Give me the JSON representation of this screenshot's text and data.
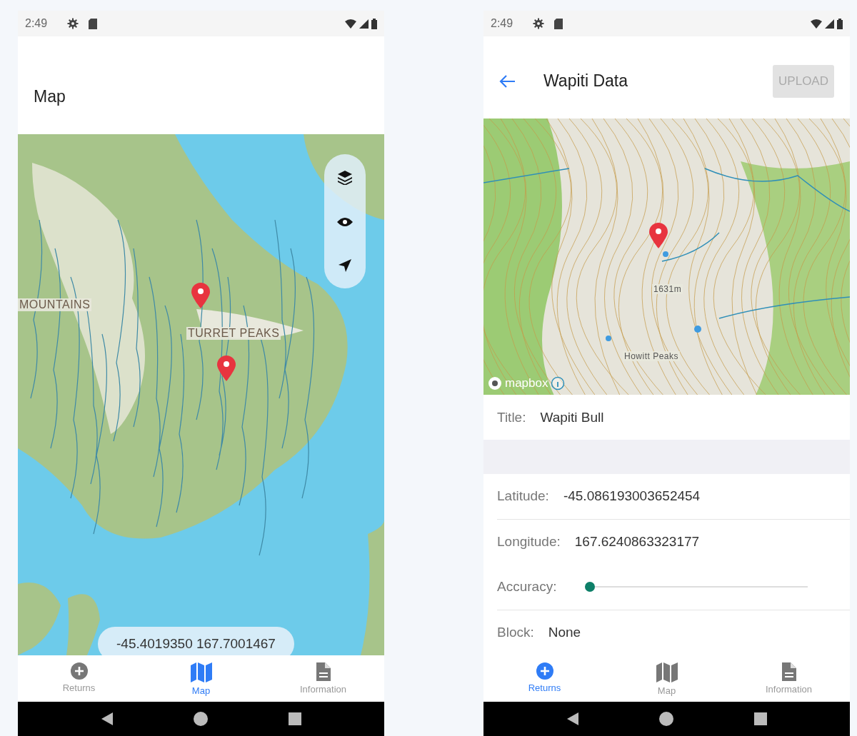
{
  "screens": [
    {
      "kind": "map",
      "status_bar": {
        "time": "2:49"
      },
      "header": {
        "title": "Map"
      },
      "map": {
        "labels": [
          "MOUNTAINS",
          "TURRET PEAKS"
        ],
        "coordinates": "-45.4019350 167.7001467"
      },
      "tabs": [
        {
          "label": "Returns",
          "selected": false
        },
        {
          "label": "Map",
          "selected": true
        },
        {
          "label": "Information",
          "selected": false
        }
      ]
    },
    {
      "kind": "detail",
      "status_bar": {
        "time": "2:49"
      },
      "header": {
        "title": "Wapiti Data",
        "action": "UPLOAD",
        "action_disabled": true
      },
      "map": {
        "labels": [
          "1631m",
          "Howitt Peaks"
        ],
        "attribution": "mapbox"
      },
      "fields": [
        {
          "kind": "text",
          "label": "Title:",
          "value": "Wapiti Bull"
        },
        {
          "kind": "gap"
        },
        {
          "kind": "text",
          "label": "Latitude:",
          "value": "-45.086193003652454"
        },
        {
          "kind": "text",
          "label": "Longitude:",
          "value": "167.6240863323177"
        },
        {
          "kind": "slider",
          "label": "Accuracy:",
          "level": 0.0
        },
        {
          "kind": "text",
          "label": "Block:",
          "value": "None"
        }
      ],
      "tabs": [
        {
          "label": "Returns",
          "selected": true
        },
        {
          "label": "Map",
          "selected": false
        },
        {
          "label": "Information",
          "selected": false
        }
      ]
    }
  ]
}
